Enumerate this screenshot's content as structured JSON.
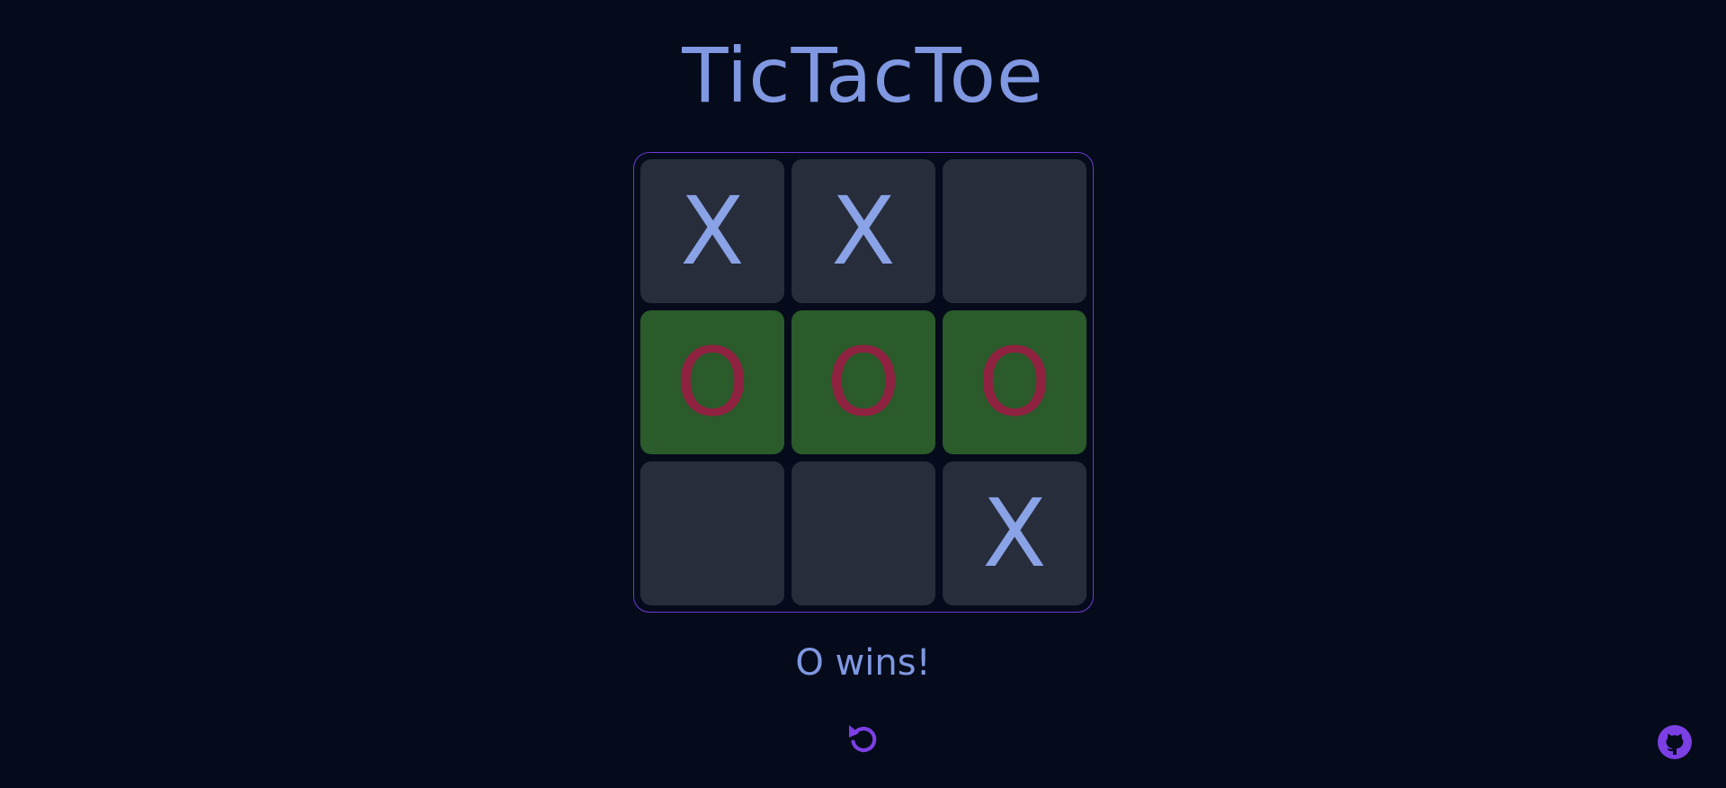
{
  "title": "TicTacToe",
  "board": {
    "cells": [
      {
        "mark": "X",
        "winning": false
      },
      {
        "mark": "X",
        "winning": false
      },
      {
        "mark": "",
        "winning": false
      },
      {
        "mark": "O",
        "winning": true
      },
      {
        "mark": "O",
        "winning": true
      },
      {
        "mark": "O",
        "winning": true
      },
      {
        "mark": "",
        "winning": false
      },
      {
        "mark": "",
        "winning": false
      },
      {
        "mark": "X",
        "winning": false
      }
    ]
  },
  "status": "O wins!",
  "icons": {
    "restart": "restart-icon",
    "github": "github-icon"
  },
  "colors": {
    "background": "#050b1a",
    "accent": "#7b3fe4",
    "text": "#8098e2",
    "cell": "#282d3b",
    "win_cell": "#2b5a2b",
    "x_mark": "#8aa2e6",
    "o_mark": "#8f2240"
  }
}
